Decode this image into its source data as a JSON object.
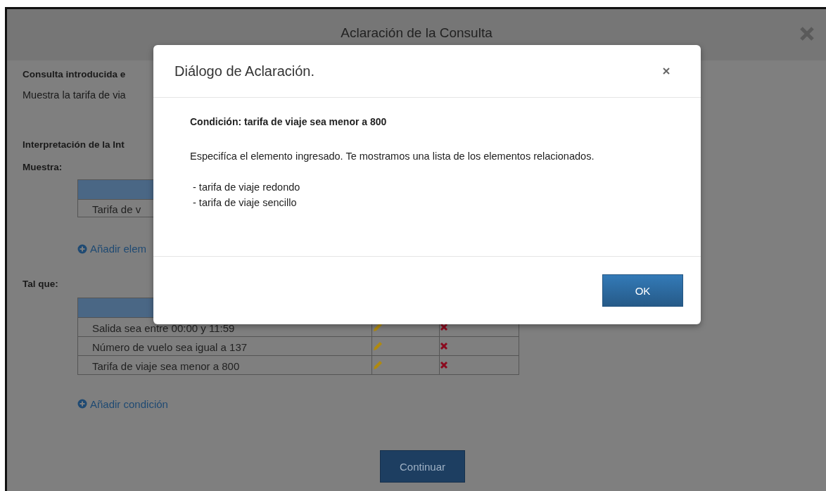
{
  "window": {
    "title": "Aclaración de la Consulta"
  },
  "query": {
    "label": "Consulta introducida e",
    "text": "Muestra la tarifa de via"
  },
  "interpretation": {
    "label": "Interpretación de la Int",
    "show": {
      "label": "Muestra:",
      "rows": [
        {
          "text": "Tarifa de v"
        }
      ],
      "add_link": "Añadir elem"
    },
    "such_that": {
      "label": "Tal que:",
      "rows": [
        {
          "text": "Salida sea entre 00:00 y 11:59"
        },
        {
          "text": "Número de vuelo sea igual a 137"
        },
        {
          "text": "Tarifa de viaje sea menor a 800"
        }
      ],
      "add_link": "Añadir condición"
    }
  },
  "continue_button": "Continuar",
  "dialog": {
    "title": "Diálogo de Aclaración.",
    "condition": "Condición: tarifa de viaje sea menor a 800",
    "message": "Especifíca el elemento ingresado. Te mostramos una lista de los elementos relacionados.",
    "options": [
      "- tarifa de viaje redondo",
      "- tarifa de viaje sencillo"
    ],
    "ok_button": "OK"
  }
}
